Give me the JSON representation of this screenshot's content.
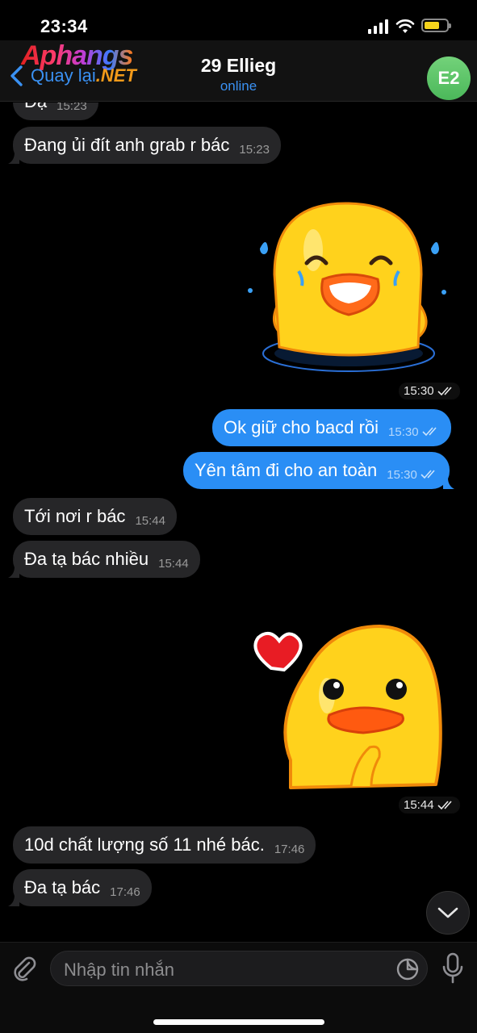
{
  "status_bar": {
    "time": "23:34"
  },
  "header": {
    "logo_text": "Aphangs",
    "back_label": "Quay lại",
    "back_suffix": ".NET",
    "contact_name": "29 Ellieg",
    "contact_status": "online",
    "avatar_initials": "E2"
  },
  "messages": [
    {
      "dir": "in",
      "text": "Dạ",
      "time": "15:23"
    },
    {
      "dir": "in",
      "text": "Đang ủi đít anh grab r bác",
      "time": "15:23"
    },
    {
      "dir": "out",
      "type": "sticker",
      "sticker": "laughing-duck",
      "time": "15:30"
    },
    {
      "dir": "out",
      "text": "Ok giữ cho bacd rồi",
      "time": "15:30"
    },
    {
      "dir": "out",
      "text": "Yên tâm đi cho an toàn",
      "time": "15:30"
    },
    {
      "dir": "in",
      "text": "Tới nơi r bác",
      "time": "15:44"
    },
    {
      "dir": "in",
      "text": "Đa tạ bác nhiều",
      "time": "15:44"
    },
    {
      "dir": "out",
      "type": "sticker",
      "sticker": "heart-duck",
      "time": "15:44"
    },
    {
      "dir": "in",
      "text": "10d chất lượng số 11 nhé bác.",
      "time": "17:46"
    },
    {
      "dir": "in",
      "text": "Đa tạ bác",
      "time": "17:46"
    }
  ],
  "composer": {
    "placeholder": "Nhập tin nhắn"
  },
  "icons": [
    "chevron-left-icon",
    "paperclip-icon",
    "sticker-icon",
    "microphone-icon",
    "chevron-down-icon",
    "double-check-icon"
  ],
  "colors": {
    "outgoing_bubble": "#2a8ef5",
    "incoming_bubble": "#262628",
    "accent": "#3a91f3",
    "avatar": "#5cc46a"
  }
}
